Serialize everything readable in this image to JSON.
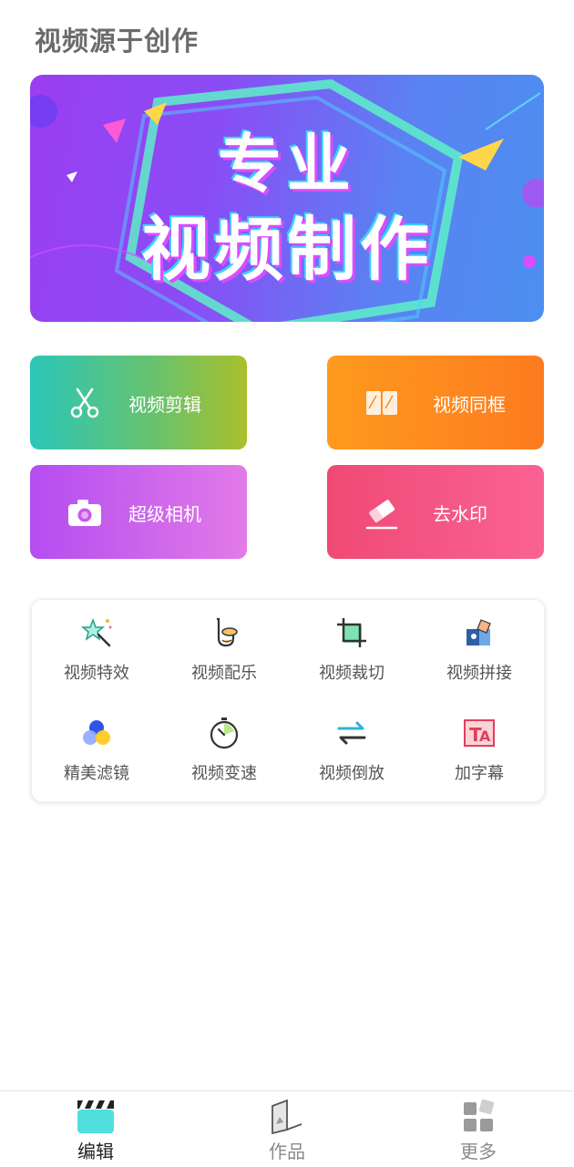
{
  "app": {
    "title": "视频源于创作"
  },
  "banner": {
    "line1": "专业",
    "line2": "视频制作"
  },
  "actions": [
    {
      "label": "视频剪辑",
      "icon": "scissors-icon"
    },
    {
      "label": "视频同框",
      "icon": "split-frame-icon"
    },
    {
      "label": "超级相机",
      "icon": "camera-icon"
    },
    {
      "label": "去水印",
      "icon": "eraser-icon"
    }
  ],
  "tools": [
    {
      "label": "视频特效",
      "icon": "magic-wand-icon"
    },
    {
      "label": "视频配乐",
      "icon": "saxophone-icon"
    },
    {
      "label": "视频裁切",
      "icon": "crop-icon"
    },
    {
      "label": "视频拼接",
      "icon": "puzzle-icon"
    },
    {
      "label": "精美滤镜",
      "icon": "filter-circles-icon"
    },
    {
      "label": "视频变速",
      "icon": "stopwatch-icon"
    },
    {
      "label": "视频倒放",
      "icon": "swap-arrows-icon"
    },
    {
      "label": "加字幕",
      "icon": "subtitle-icon"
    }
  ],
  "nav": [
    {
      "label": "编辑",
      "icon": "clapperboard-icon",
      "active": true
    },
    {
      "label": "作品",
      "icon": "gallery-icon",
      "active": false
    },
    {
      "label": "更多",
      "icon": "grid-icon",
      "active": false
    }
  ],
  "colors": {
    "title": "#6b6b6b",
    "edit_gradient": [
      "#2bc6b8",
      "#a9c02b"
    ],
    "frame_gradient": [
      "#fe9a1e",
      "#fd7b1f"
    ],
    "camera_gradient": [
      "#b44df0",
      "#e27ae8"
    ],
    "erase_gradient": [
      "#ef4a74",
      "#fa6294"
    ],
    "nav_active": "#222222",
    "nav_inactive": "#8a8a8a"
  }
}
